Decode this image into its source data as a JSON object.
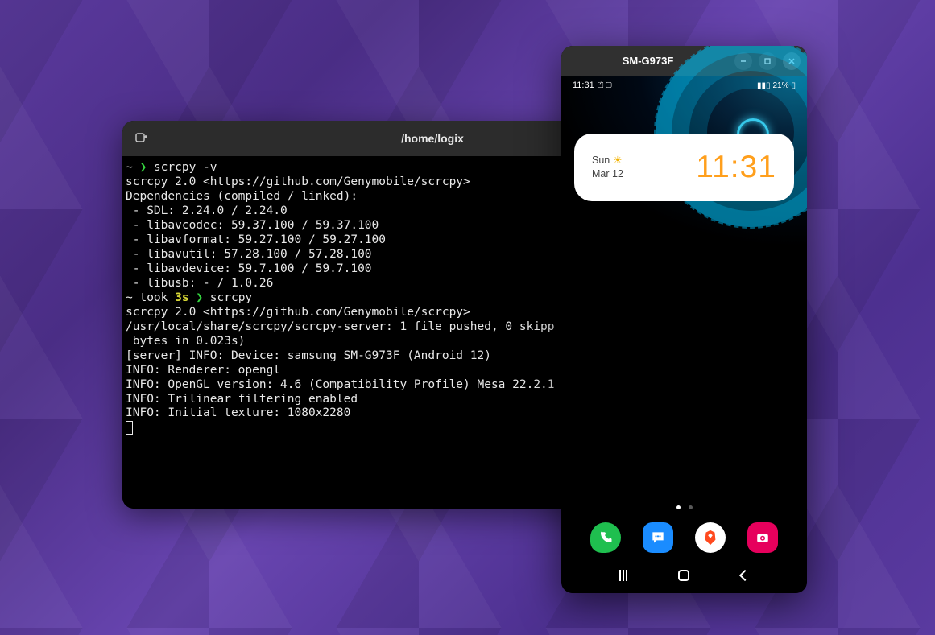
{
  "terminal": {
    "title": "/home/logix",
    "prompt1_cmd": "scrcpy -v",
    "lines_block1": [
      "scrcpy 2.0 <https://github.com/Genymobile/scrcpy>",
      "",
      "Dependencies (compiled / linked):",
      " - SDL: 2.24.0 / 2.24.0",
      " - libavcodec: 59.37.100 / 59.37.100",
      " - libavformat: 59.27.100 / 59.27.100",
      " - libavutil: 57.28.100 / 57.28.100",
      " - libavdevice: 59.7.100 / 59.7.100",
      " - libusb: - / 1.0.26"
    ],
    "took_label": "took ",
    "took_time": "3s",
    "prompt2_cmd": "scrcpy",
    "lines_block2": [
      "scrcpy 2.0 <https://github.com/Genymobile/scrcpy>",
      "/usr/local/share/scrcpy/scrcpy-server: 1 file pushed, 0 skipp",
      " bytes in 0.023s)",
      "[server] INFO: Device: samsung SM-G973F (Android 12)",
      "INFO: Renderer: opengl",
      "INFO: OpenGL version: 4.6 (Compatibility Profile) Mesa 22.2.1",
      "INFO: Trilinear filtering enabled",
      "INFO: Initial texture: 1080x2280"
    ]
  },
  "phone": {
    "window_title": "SM-G973F",
    "status": {
      "time": "11:31",
      "left_icons": "⏍ ▢",
      "right_text": "21%",
      "right_icons": "📶 ⚡"
    },
    "widget": {
      "day": "Sun",
      "date": "Mar 12",
      "time": "11:31"
    },
    "dock": {
      "phone": "phone",
      "messages": "messages",
      "brave": "brave",
      "camera": "camera"
    }
  }
}
